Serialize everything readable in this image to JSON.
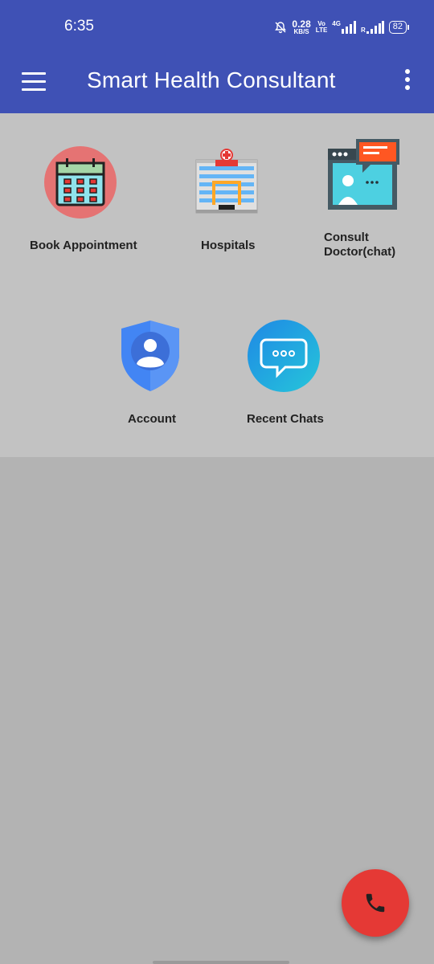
{
  "status_bar": {
    "time": "6:35",
    "net_speed_value": "0.28",
    "net_speed_unit": "KB/S",
    "volte": "Vo",
    "volte_sub": "LTE",
    "network_type": "4G",
    "roaming": "R",
    "battery": "82"
  },
  "appbar": {
    "title": "Smart Health Consultant",
    "menu_icon": "hamburger-menu-icon",
    "overflow_icon": "more-vert-icon"
  },
  "tiles": {
    "book_appointment": {
      "label": "Book Appointment",
      "icon": "calendar-icon"
    },
    "hospitals": {
      "label": "Hospitals",
      "icon": "hospital-building-icon"
    },
    "consult_doctor": {
      "label_line1": "Consult",
      "label_line2": "Doctor(chat)",
      "icon": "doctor-chat-icon"
    },
    "account": {
      "label": "Account",
      "icon": "account-shield-icon"
    },
    "recent_chats": {
      "label": "Recent Chats",
      "icon": "chat-bubble-icon"
    }
  },
  "fab": {
    "icon": "phone-icon"
  },
  "colors": {
    "primary": "#3f51b5",
    "fab": "#e53935",
    "panel": "#c2c2c2",
    "background": "#b3b3b3"
  }
}
